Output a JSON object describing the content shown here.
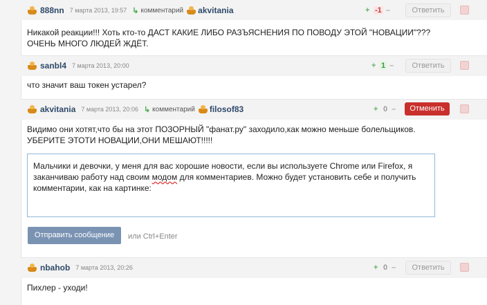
{
  "comments": [
    {
      "author": "888nn",
      "date": "7 марта 2013, 19:57",
      "reply_label": "комментарий",
      "reply_to": "akvitania",
      "plus": "+",
      "score": "-1",
      "minus": "–",
      "action_label": "Ответить",
      "text": "Никакой реакции!!! Хоть кто-то ДАСТ КАКИЕ ЛИБО РАЗЪЯСНЕНИЯ ПО ПОВОДУ ЭТОЙ \"НОВАЦИИ\"??? ОЧЕНЬ МНОГО ЛЮДЕЙ ЖДЁТ."
    },
    {
      "author": "sanbl4",
      "date": "7 марта 2013, 20:00",
      "plus": "+",
      "score": "1",
      "minus": "–",
      "action_label": "Ответить",
      "text": "что значит ваш токен устарел?"
    },
    {
      "author": "akvitania",
      "date": "7 марта 2013, 20:06",
      "reply_label": "комментарий",
      "reply_to": "filosof83",
      "plus": "+",
      "score": "0",
      "minus": "–",
      "action_label": "Отменить",
      "text": "Видимо они хотят,что бы на этот ПОЗОРНЫЙ \"фанат.ру\" заходило,как можно меньше болельщиков. УБЕРИТЕ ЭТОТИ НОВАЦИИ,ОНИ МЕШАЮТ!!!!!"
    },
    {
      "author": "nbahob",
      "date": "7 марта 2013, 20:26",
      "plus": "+",
      "score": "0",
      "minus": "–",
      "action_label": "Ответить",
      "text": "Пихлер - уходи!"
    }
  ],
  "reply_form": {
    "text_before": "Мальчики и девочки, у меня для вас хорошие новости, если вы используете Chrome или Firefox, я заканчиваю работу над своим ",
    "text_underlined": "модом",
    "text_after": " для комментариев. Можно будет установить себе и получить комментарии, как на картинке:",
    "send_label": "Отправить сообщение",
    "hint": "или Ctrl+Enter"
  },
  "colors": {
    "accent": "#2f4a6a",
    "cancel": "#c9302c",
    "send": "#7a93b3",
    "textarea_border": "#8fb7d9"
  },
  "icons": {
    "avatar": "user-avatar-icon",
    "reply": "reply-arrow-icon",
    "flag": "flag-icon"
  }
}
